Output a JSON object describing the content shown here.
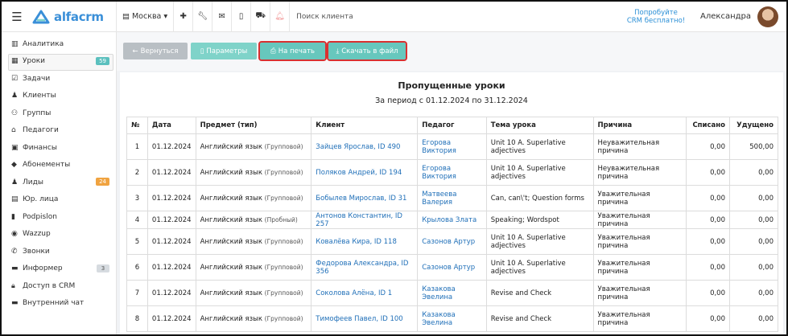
{
  "topbar": {
    "logo_text": "alfacrm",
    "city": "Москва",
    "search_placeholder": "Поиск клиента",
    "promo_line1": "Попробуйте",
    "promo_line2": "CRM бесплатно!",
    "user_name": "Александра"
  },
  "sidebar": {
    "items": [
      {
        "label": "Аналитика",
        "icon": "chart-icon"
      },
      {
        "label": "Уроки",
        "icon": "calendar-icon",
        "badge": "59"
      },
      {
        "label": "Задачи",
        "icon": "tasks-icon"
      },
      {
        "label": "Клиенты",
        "icon": "user-icon"
      },
      {
        "label": "Группы",
        "icon": "group-icon"
      },
      {
        "label": "Педагоги",
        "icon": "graduation-cap-icon"
      },
      {
        "label": "Финансы",
        "icon": "money-icon"
      },
      {
        "label": "Абонементы",
        "icon": "tag-icon"
      },
      {
        "label": "Лиды",
        "icon": "leads-icon",
        "badge": "24"
      },
      {
        "label": "Юр. лица",
        "icon": "building-icon"
      },
      {
        "label": "Podpislon",
        "icon": "podpislon-icon"
      },
      {
        "label": "Wazzup",
        "icon": "whatsapp-icon"
      },
      {
        "label": "Звонки",
        "icon": "phone-icon"
      },
      {
        "label": "Информер",
        "icon": "informer-icon",
        "badge": "3"
      },
      {
        "label": "Доступ в CRM",
        "icon": "lock-icon"
      },
      {
        "label": "Внутренний чат",
        "icon": "chat-icon"
      }
    ]
  },
  "toolbar": {
    "back_label": "Вернуться",
    "params_label": "Параметры",
    "print_label": "На печать",
    "download_label": "Скачать в файл"
  },
  "report": {
    "title": "Пропущенные уроки",
    "period": "За период с 01.12.2024 по 31.12.2024",
    "columns": [
      "№",
      "Дата",
      "Предмет (тип)",
      "Клиент",
      "Педагог",
      "Тема урока",
      "Причина",
      "Списано",
      "Удущено"
    ],
    "rows": [
      {
        "n": "1",
        "date": "01.12.2024",
        "subject": "Английский язык",
        "type": "(Групповой)",
        "client": "Зайцев Ярослав, ID 490",
        "teacher": "Егорова Виктория",
        "topic": "Unit 10 A. Superlative adjectives",
        "reason": "Неуважительная причина",
        "charged": "0,00",
        "lost": "500,00"
      },
      {
        "n": "2",
        "date": "01.12.2024",
        "subject": "Английский язык",
        "type": "(Групповой)",
        "client": "Поляков Андрей, ID 194",
        "teacher": "Егорова Виктория",
        "topic": "Unit 10 A. Superlative adjectives",
        "reason": "Неуважительная причина",
        "charged": "0,00",
        "lost": "0,00"
      },
      {
        "n": "3",
        "date": "01.12.2024",
        "subject": "Английский язык",
        "type": "(Групповой)",
        "client": "Бобылев Мирослав, ID 31",
        "teacher": "Матвеева Валерия",
        "topic": "Can, can\\'t; Question forms",
        "reason": "Уважительная причина",
        "charged": "0,00",
        "lost": "0,00"
      },
      {
        "n": "4",
        "date": "01.12.2024",
        "subject": "Английский язык",
        "type": "(Пробный)",
        "client": "Антонов Константин, ID 257",
        "teacher": "Крылова Злата",
        "topic": "Speaking; Wordspot",
        "reason": "Уважительная причина",
        "charged": "0,00",
        "lost": "0,00"
      },
      {
        "n": "5",
        "date": "01.12.2024",
        "subject": "Английский язык",
        "type": "(Групповой)",
        "client": "Ковалёва Кира, ID 118",
        "teacher": "Сазонов Артур",
        "topic": "Unit 10 A. Superlative adjectives",
        "reason": "Уважительная причина",
        "charged": "0,00",
        "lost": "0,00"
      },
      {
        "n": "6",
        "date": "01.12.2024",
        "subject": "Английский язык",
        "type": "(Групповой)",
        "client": "Федорова Александра, ID 356",
        "teacher": "Сазонов Артур",
        "topic": "Unit 10 A. Superlative adjectives",
        "reason": "Уважительная причина",
        "charged": "0,00",
        "lost": "0,00"
      },
      {
        "n": "7",
        "date": "01.12.2024",
        "subject": "Английский язык",
        "type": "(Групповой)",
        "client": "Соколова Алёна, ID 1",
        "teacher": "Казакова Эвелина",
        "topic": "Revise and Check",
        "reason": "Уважительная причина",
        "charged": "0,00",
        "lost": "0,00"
      },
      {
        "n": "8",
        "date": "01.12.2024",
        "subject": "Английский язык",
        "type": "(Групповой)",
        "client": "Тимофеев Павел, ID 100",
        "teacher": "Казакова Эвелина",
        "topic": "Revise and Check",
        "reason": "Уважительная причина",
        "charged": "0,00",
        "lost": "0,00"
      }
    ]
  }
}
